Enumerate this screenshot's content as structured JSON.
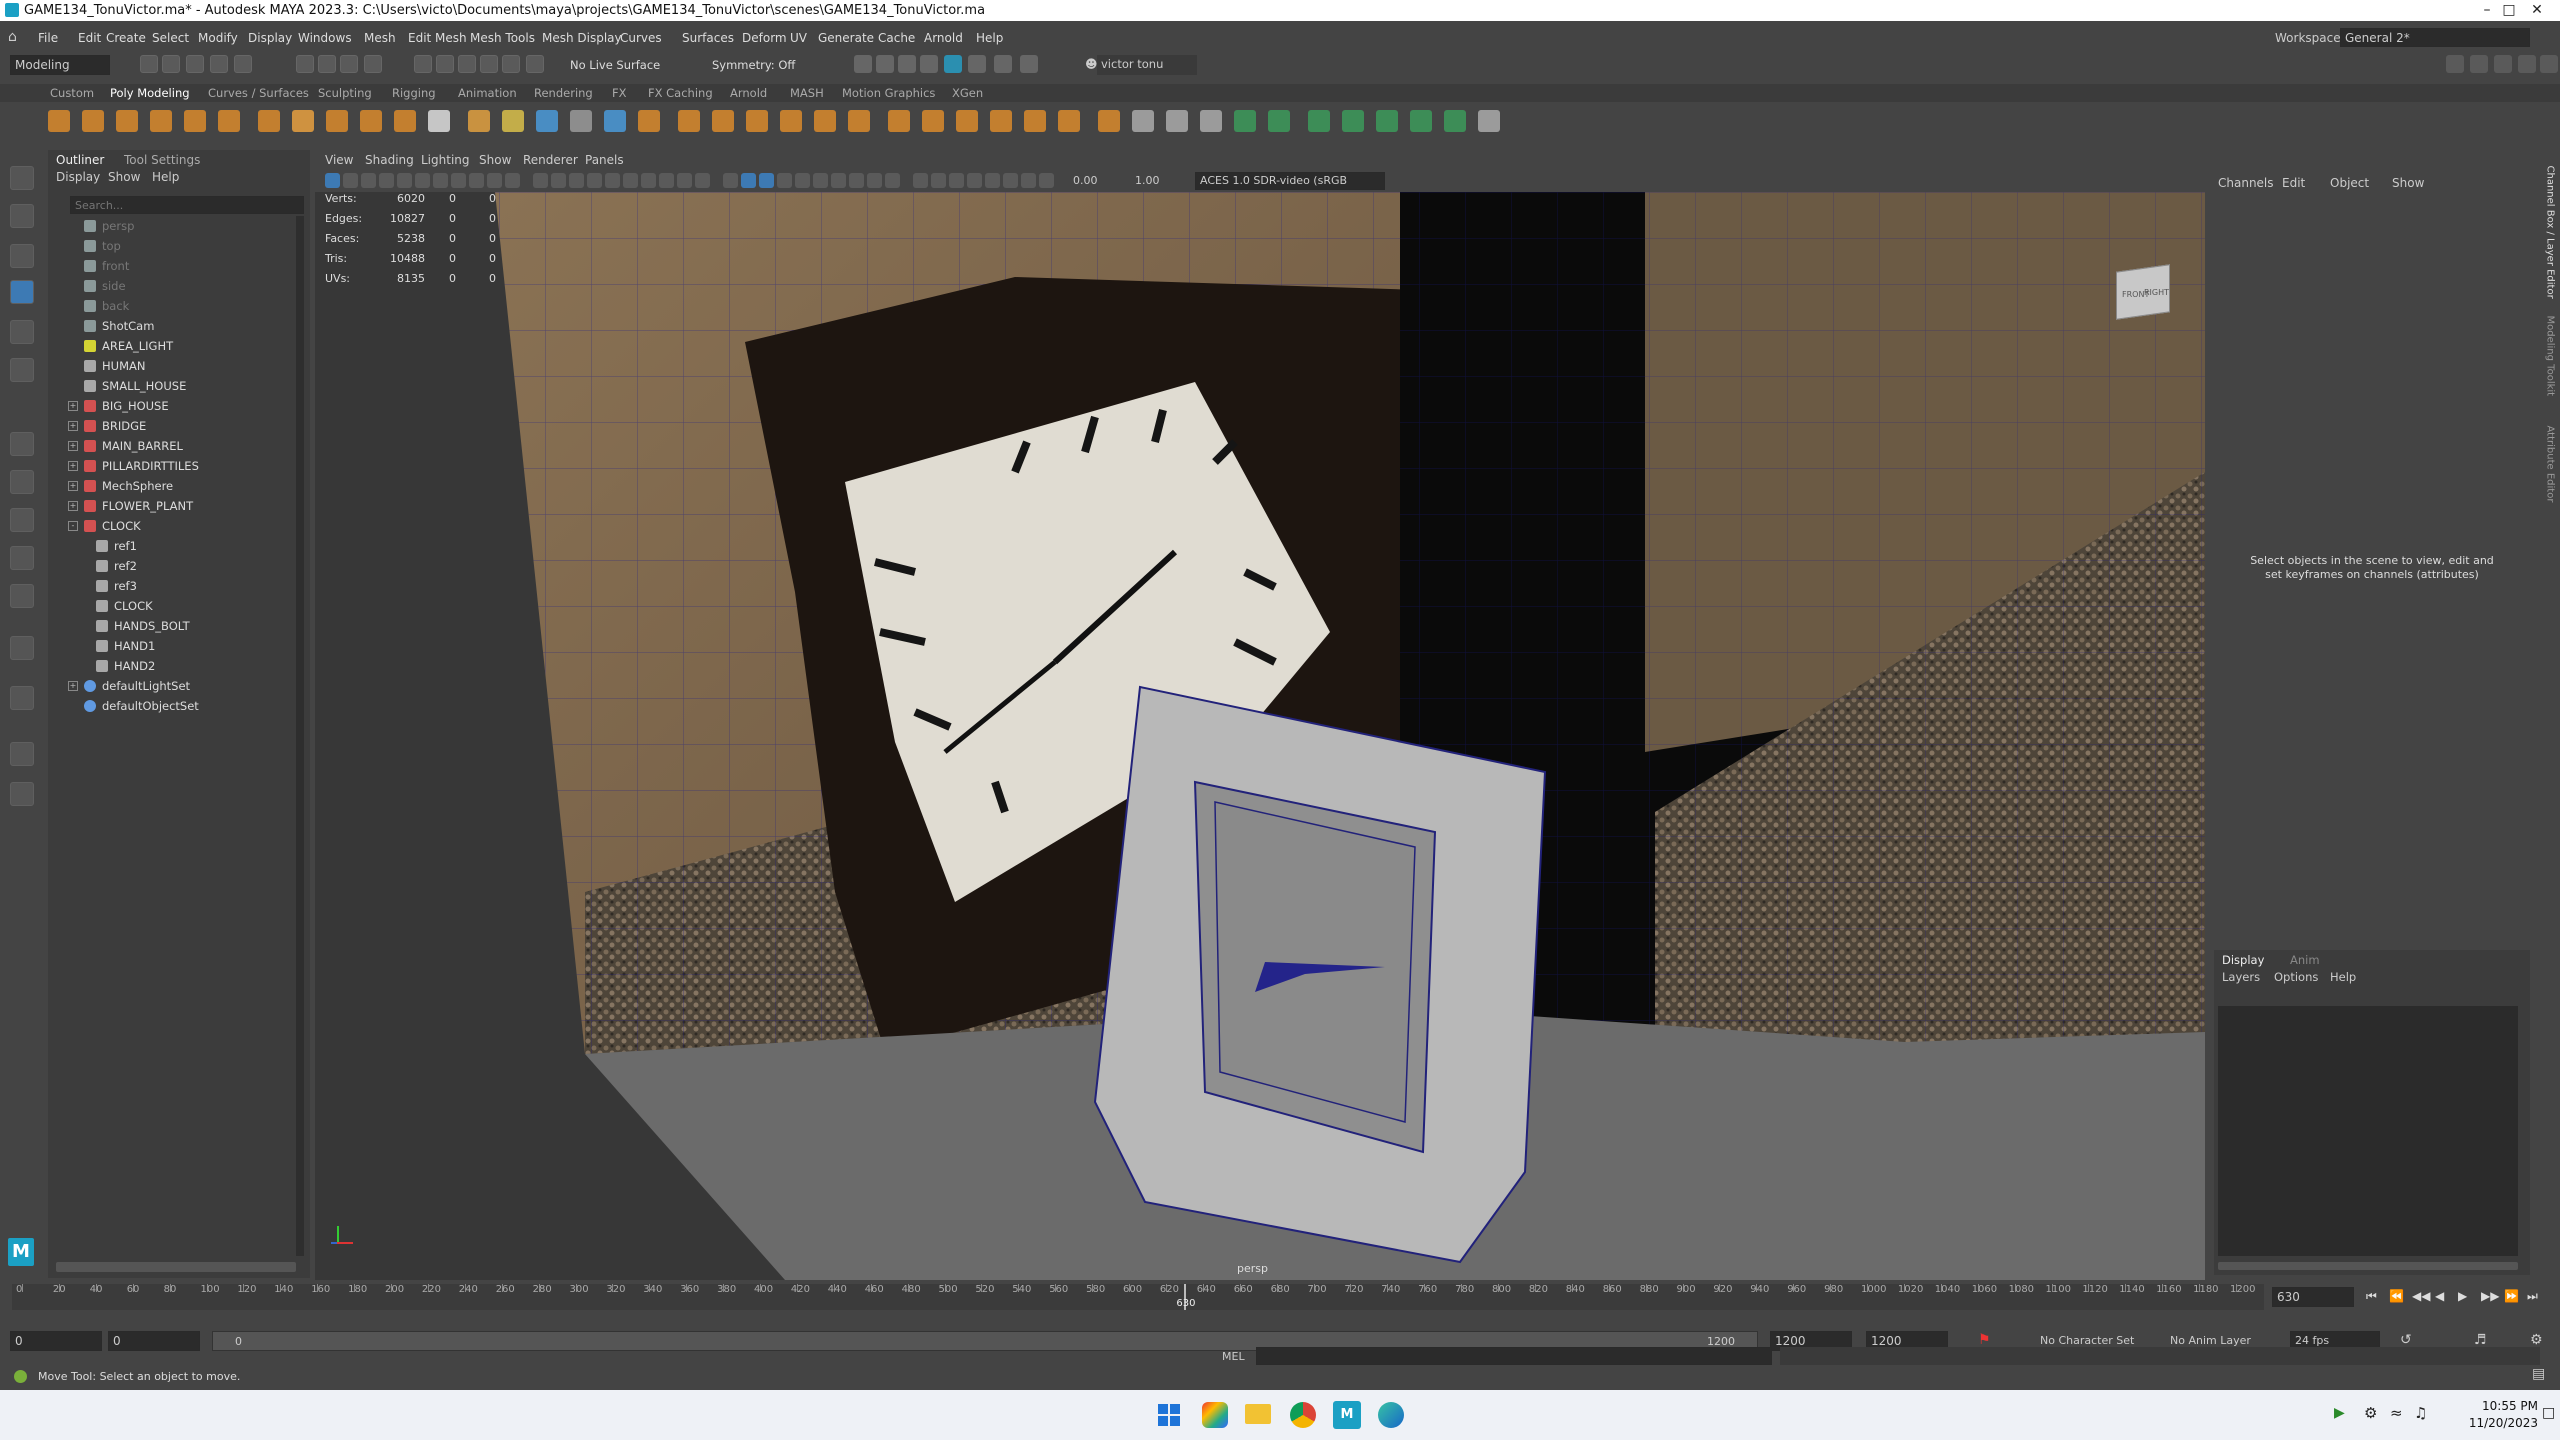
{
  "window": {
    "title": "GAME134_TonuVictor.ma* - Autodesk MAYA 2023.3: C:\\Users\\victo\\Documents\\maya\\projects\\GAME134_TonuVictor\\scenes\\GAME134_TonuVictor.ma"
  },
  "menu": [
    "File",
    "Edit",
    "Create",
    "Select",
    "Modify",
    "Display",
    "Windows",
    "Mesh",
    "Edit Mesh",
    "Mesh Tools",
    "Mesh Display",
    "Curves",
    "Surfaces",
    "Deform",
    "UV",
    "Generate",
    "Cache",
    "Arnold",
    "Help"
  ],
  "workspace": {
    "label": "Workspace:",
    "value": "General 2*"
  },
  "status": {
    "mode": "Modeling",
    "live_surface": "No Live Surface",
    "symmetry": "Symmetry: Off",
    "user": "victor tonu"
  },
  "shelf_tabs": [
    "Custom",
    "Poly Modeling",
    "Curves / Surfaces",
    "Sculpting",
    "Rigging",
    "Animation",
    "Rendering",
    "FX",
    "FX Caching",
    "Arnold",
    "MASH",
    "Motion Graphics",
    "XGen"
  ],
  "shelf_active": "Poly Modeling",
  "outliner": {
    "tabs": [
      "Outliner",
      "Tool Settings"
    ],
    "menu": [
      "Display",
      "Show",
      "Help"
    ],
    "search_placeholder": "Search...",
    "items": [
      {
        "label": "persp",
        "kind": "camera",
        "dim": true,
        "expand": ""
      },
      {
        "label": "top",
        "kind": "camera",
        "dim": true,
        "expand": ""
      },
      {
        "label": "front",
        "kind": "camera",
        "dim": true,
        "expand": ""
      },
      {
        "label": "side",
        "kind": "camera",
        "dim": true,
        "expand": ""
      },
      {
        "label": "back",
        "kind": "camera",
        "dim": true,
        "expand": ""
      },
      {
        "label": "ShotCam",
        "kind": "camera",
        "dim": false,
        "expand": ""
      },
      {
        "label": "AREA_LIGHT",
        "kind": "light",
        "dim": false,
        "expand": ""
      },
      {
        "label": "HUMAN",
        "kind": "transform",
        "dim": false,
        "expand": ""
      },
      {
        "label": "SMALL_HOUSE",
        "kind": "transform",
        "dim": false,
        "expand": ""
      },
      {
        "label": "BIG_HOUSE",
        "kind": "group",
        "dim": false,
        "expand": "+"
      },
      {
        "label": "BRIDGE",
        "kind": "group",
        "dim": false,
        "expand": "+"
      },
      {
        "label": "MAIN_BARREL",
        "kind": "group",
        "dim": false,
        "expand": "+"
      },
      {
        "label": "PILLARDIRTTILES",
        "kind": "group",
        "dim": false,
        "expand": "+"
      },
      {
        "label": "MechSphere",
        "kind": "group",
        "dim": false,
        "expand": "+"
      },
      {
        "label": "FLOWER_PLANT",
        "kind": "group",
        "dim": false,
        "expand": "+"
      },
      {
        "label": "CLOCK",
        "kind": "group",
        "dim": false,
        "expand": "-"
      },
      {
        "label": "ref1",
        "kind": "transform",
        "dim": false,
        "expand": "",
        "indent": 1
      },
      {
        "label": "ref2",
        "kind": "transform",
        "dim": false,
        "expand": "",
        "indent": 1
      },
      {
        "label": "ref3",
        "kind": "transform",
        "dim": false,
        "expand": "",
        "indent": 1
      },
      {
        "label": "CLOCK",
        "kind": "transform",
        "dim": false,
        "expand": "",
        "indent": 1
      },
      {
        "label": "HANDS_BOLT",
        "kind": "transform",
        "dim": false,
        "expand": "",
        "indent": 1
      },
      {
        "label": "HAND1",
        "kind": "transform",
        "dim": false,
        "expand": "",
        "indent": 1
      },
      {
        "label": "HAND2",
        "kind": "transform",
        "dim": false,
        "expand": "",
        "indent": 1
      },
      {
        "label": "defaultLightSet",
        "kind": "set",
        "dim": false,
        "expand": "+"
      },
      {
        "label": "defaultObjectSet",
        "kind": "set",
        "dim": false,
        "expand": ""
      }
    ]
  },
  "viewport": {
    "menu": [
      "View",
      "Shading",
      "Lighting",
      "Show",
      "Renderer",
      "Panels"
    ],
    "near_value": "0.00",
    "far_value": "1.00",
    "color_space": "ACES 1.0 SDR-video (sRGB",
    "camera_label": "persp",
    "viewcube_front": "FRONT",
    "viewcube_right": "RIGHT",
    "stats": [
      {
        "label": "Verts:",
        "a": "6020",
        "b": "0",
        "c": "0"
      },
      {
        "label": "Edges:",
        "a": "10827",
        "b": "0",
        "c": "0"
      },
      {
        "label": "Faces:",
        "a": "5238",
        "b": "0",
        "c": "0"
      },
      {
        "label": "Tris:",
        "a": "10488",
        "b": "0",
        "c": "0"
      },
      {
        "label": "UVs:",
        "a": "8135",
        "b": "0",
        "c": "0"
      }
    ]
  },
  "channel_box": {
    "menu": [
      "Channels",
      "Edit",
      "Object",
      "Show"
    ],
    "message": "Select objects in the scene to view, edit and set keyframes on channels (attributes)",
    "side_tabs": [
      "Channel Box / Layer Editor",
      "Modeling Toolkit",
      "Attribute Editor"
    ],
    "layer_tabs": [
      "Display",
      "Anim"
    ],
    "layer_menu": [
      "Layers",
      "Options",
      "Help"
    ]
  },
  "timeline": {
    "ticks": [
      "0",
      "20",
      "40",
      "60",
      "80",
      "100",
      "120",
      "140",
      "160",
      "180",
      "200",
      "220",
      "240",
      "260",
      "280",
      "300",
      "320",
      "340",
      "360",
      "380",
      "400",
      "420",
      "440",
      "460",
      "480",
      "500",
      "520",
      "540",
      "560",
      "580",
      "600",
      "620",
      "640",
      "660",
      "680",
      "700",
      "720",
      "740",
      "760",
      "780",
      "800",
      "820",
      "840",
      "860",
      "880",
      "900",
      "920",
      "940",
      "960",
      "980",
      "1000",
      "1020",
      "1040",
      "1060",
      "1080",
      "1100",
      "1120",
      "1140",
      "1160",
      "1180",
      "1200"
    ],
    "current_frame": "630",
    "current_label": "630"
  },
  "range": {
    "start": "0",
    "inner_start": "0",
    "slider_start": "0",
    "slider_end": "1200",
    "end": "1200",
    "outer_end": "1200",
    "character_set": "No Character Set",
    "anim_layer": "No Anim Layer",
    "fps": "24 fps"
  },
  "command": {
    "lang": "MEL",
    "help": "Move Tool: Select an object to move."
  },
  "taskbar": {
    "time": "10:55 PM",
    "date": "11/20/2023"
  }
}
